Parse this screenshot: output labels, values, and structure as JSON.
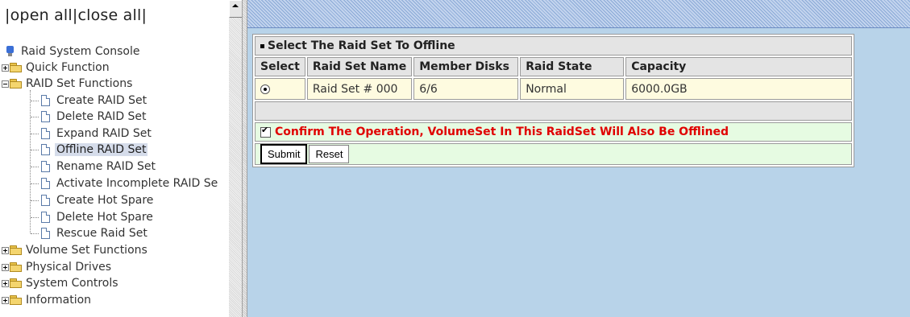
{
  "tree": {
    "open_all": "open all",
    "close_all": "close all",
    "root": "Raid System Console",
    "items": [
      {
        "label": "Quick Function"
      },
      {
        "label": "RAID Set Functions",
        "children": [
          "Create RAID Set",
          "Delete RAID Set",
          "Expand RAID Set",
          "Offline RAID Set",
          "Rename RAID Set",
          "Activate Incomplete RAID Se",
          "Create Hot Spare",
          "Delete Hot Spare",
          "Rescue Raid Set"
        ]
      },
      {
        "label": "Volume Set Functions"
      },
      {
        "label": "Physical Drives"
      },
      {
        "label": "System Controls"
      },
      {
        "label": "Information"
      }
    ],
    "selected": "Offline RAID Set"
  },
  "panel": {
    "title": "Select The Raid Set To Offline",
    "columns": [
      "Select",
      "Raid Set Name",
      "Member Disks",
      "Raid State",
      "Capacity"
    ],
    "rows": [
      {
        "name": "Raid Set # 000",
        "disks": "6/6",
        "state": "Normal",
        "capacity": "6000.0GB",
        "selected": true
      }
    ],
    "confirm_text": "Confirm The Operation, VolumeSet In This RaidSet Will Also Be Offlined",
    "confirm_checked": true,
    "submit": "Submit",
    "reset": "Reset"
  }
}
